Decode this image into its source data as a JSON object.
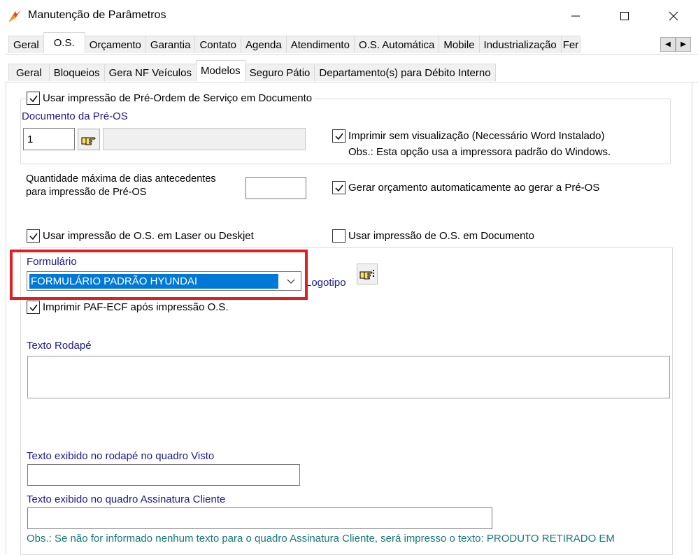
{
  "window": {
    "title": "Manutenção de Parâmetros",
    "icons": {
      "app": "app-logo-icon",
      "minimize": "minimize-icon",
      "maximize": "maximize-icon",
      "close": "close-icon"
    }
  },
  "tabs_main": [
    {
      "label": "Geral",
      "active": false
    },
    {
      "label": "O.S.",
      "active": true
    },
    {
      "label": "Orçamento",
      "active": false
    },
    {
      "label": "Garantia",
      "active": false
    },
    {
      "label": "Contato",
      "active": false
    },
    {
      "label": "Agenda",
      "active": false
    },
    {
      "label": "Atendimento",
      "active": false
    },
    {
      "label": "O.S. Automática",
      "active": false
    },
    {
      "label": "Mobile",
      "active": false
    },
    {
      "label": "Industrialização",
      "active": false
    },
    {
      "label": "Fer",
      "active": false
    }
  ],
  "tabs_sub": [
    {
      "label": "Geral",
      "active": false
    },
    {
      "label": "Bloqueios",
      "active": false
    },
    {
      "label": "Gera NF Veículos",
      "active": false
    },
    {
      "label": "Modelos",
      "active": true
    },
    {
      "label": "Seguro Pátio",
      "active": false
    },
    {
      "label": "Departamento(s) para Débito Interno",
      "active": false
    }
  ],
  "preos": {
    "checkbox_label": "Usar impressão de Pré-Ordem de Serviço em Documento",
    "checked": true,
    "doc_label": "Documento da Pré-OS",
    "doc_value": "1",
    "print_no_preview_label": "Imprimir sem visualização (Necessário Word Instalado)",
    "print_no_preview_checked": true,
    "print_note": "Obs.: Esta opção usa a impressora padrão do Windows."
  },
  "days": {
    "label_line1": "Quantidade máxima de dias antecedentes",
    "label_line2": "para impressão de Pré-OS",
    "value": ""
  },
  "auto_budget": {
    "label": "Gerar orçamento automaticamente ao gerar a Pré-OS",
    "checked": true
  },
  "laser": {
    "label": "Usar impressão de O.S. em Laser ou Deskjet",
    "checked": true
  },
  "os_doc": {
    "label": "Usar impressão de O.S. em Documento",
    "checked": false
  },
  "form": {
    "formulario_label": "Formulário",
    "formulario_value": "FORMULÁRIO PADRÃO HYUNDAI",
    "logotipo_label": "Logotipo",
    "paf_label": "Imprimir PAF-ECF após impressão O.S.",
    "paf_checked": true,
    "rodape_label": "Texto Rodapé",
    "rodape_value": "",
    "visto_label": "Texto exibido no rodapé no quadro Visto",
    "visto_value": "",
    "assinatura_label": "Texto exibido no quadro Assinatura Cliente",
    "assinatura_value": "",
    "obs": "Obs.: Se não for informado nenhum texto para o quadro Assinatura Cliente, será impresso o texto: PRODUTO RETIRADO EM"
  },
  "colors": {
    "highlight": "#e02020",
    "label_blue": "#1a1a8c",
    "note_teal": "#147878",
    "selection": "#0078d7"
  }
}
